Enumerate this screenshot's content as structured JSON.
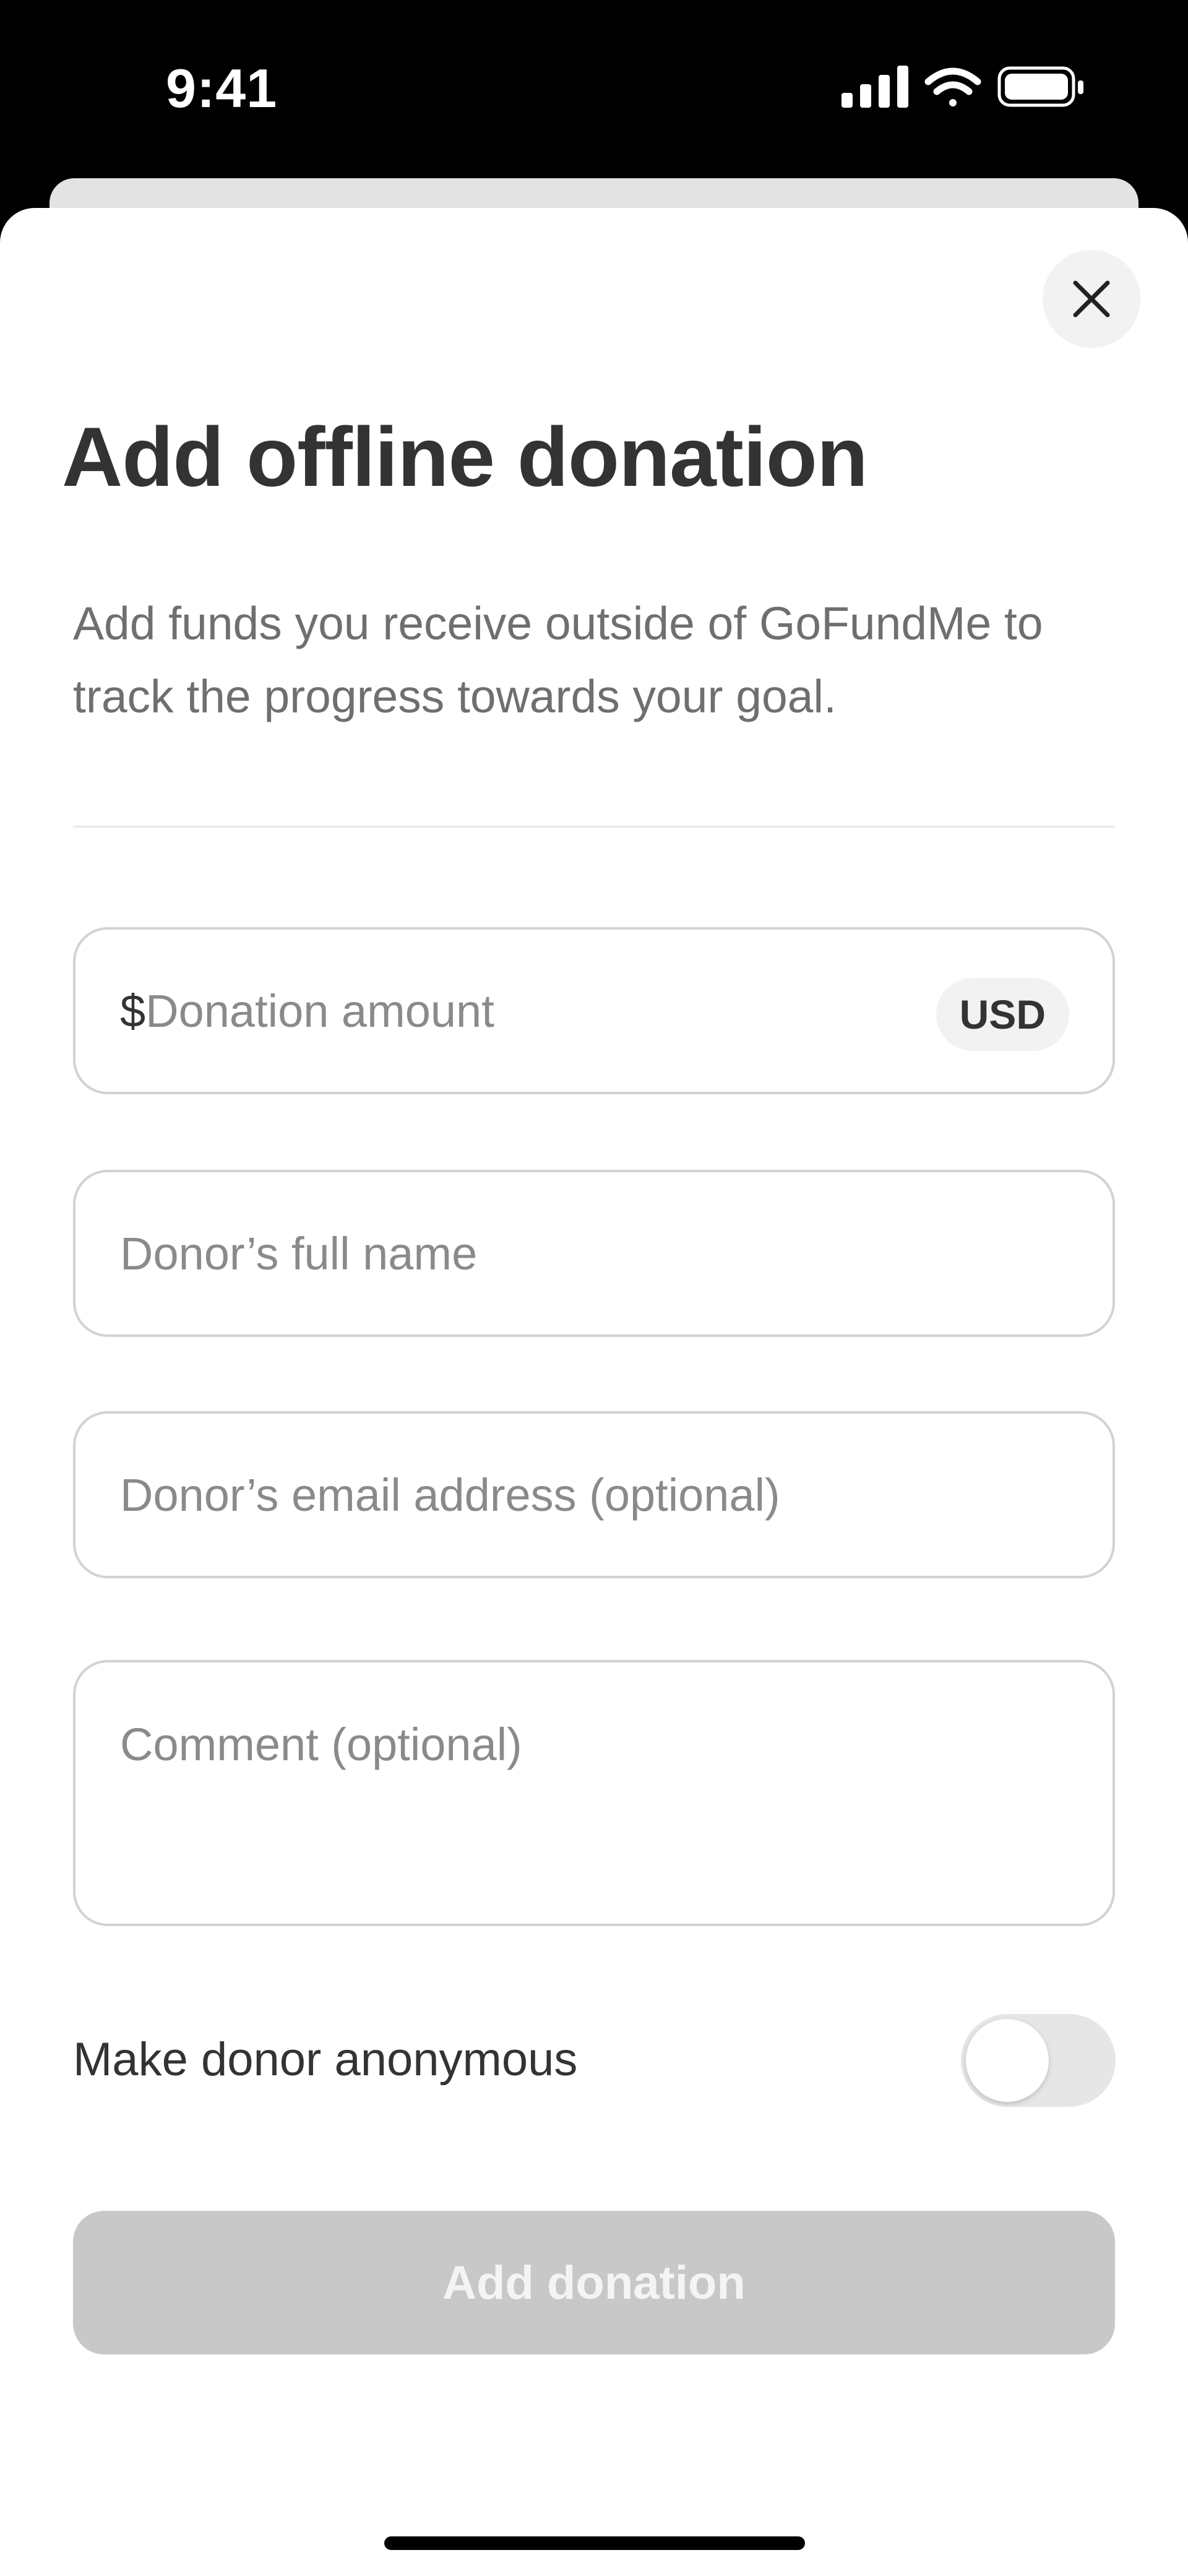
{
  "status_bar": {
    "time": "9:41",
    "icons": [
      "signal-icon",
      "wifi-icon",
      "battery-icon"
    ]
  },
  "modal": {
    "close_icon": "close-icon",
    "title": "Add offline donation",
    "subtitle": "Add funds you receive outside of GoFundMe to track the progress towards your goal."
  },
  "form": {
    "amount_prefix": "$",
    "amount_placeholder": "Donation amount",
    "currency": "USD",
    "name_placeholder": "Donor’s full name",
    "email_placeholder": "Donor’s email address (optional)",
    "comment_placeholder": "Comment (optional)",
    "anonymous_label": "Make donor anonymous",
    "anonymous_on": false,
    "submit_label": "Add donation"
  },
  "colors": {
    "title": "#333333",
    "placeholder": "#8a8a8a",
    "button_disabled": "#c8c8c8",
    "toggle_off": "#e6e6e6"
  }
}
